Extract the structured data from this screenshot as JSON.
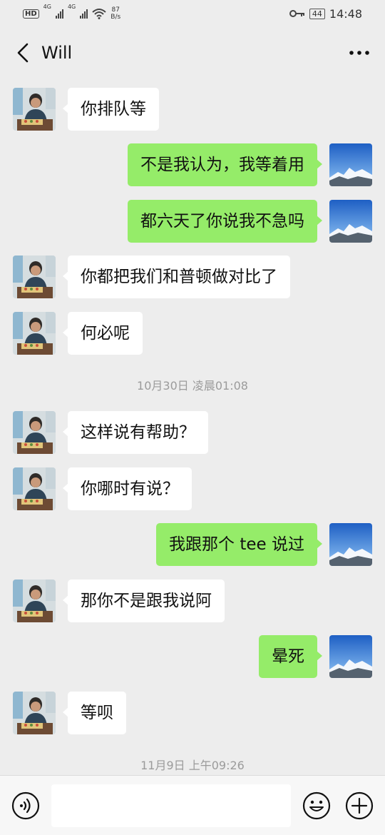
{
  "status_bar": {
    "hd": "HD",
    "network_1": "4G",
    "network_2": "4G",
    "speed_value": "87",
    "speed_unit": "B/s",
    "battery": "44",
    "time": "14:48"
  },
  "header": {
    "title": "Will",
    "back_icon": "chevron-left-icon",
    "more_icon": "more-dots-icon"
  },
  "messages": [
    {
      "side": "in",
      "text": "你排队等"
    },
    {
      "side": "out",
      "text": "不是我认为，我等着用"
    },
    {
      "side": "out",
      "text": "都六天了你说我不急吗"
    },
    {
      "side": "in",
      "text": "你都把我们和普顿做对比了"
    },
    {
      "side": "in",
      "text": "何必呢"
    },
    {
      "side": "in",
      "text": "这样说有帮助？"
    },
    {
      "side": "in",
      "text": "你哪时有说？"
    },
    {
      "side": "out",
      "text": "我跟那个 tee 说过"
    },
    {
      "side": "in",
      "text": "那你不是跟我说阿"
    },
    {
      "side": "out",
      "text": "晕死"
    },
    {
      "side": "in",
      "text": "等呗"
    }
  ],
  "timestamps": [
    "10月30日 凌晨01:08",
    "11月9日 上午09:26"
  ],
  "input": {
    "value": "",
    "placeholder": ""
  },
  "icons": {
    "voice": "voice-icon",
    "emoji": "emoji-icon",
    "plus": "plus-icon"
  },
  "colors": {
    "background": "#ededed",
    "incoming_bubble": "#ffffff",
    "outgoing_bubble": "#95ec69",
    "timestamp_text": "#9b9b9b"
  }
}
